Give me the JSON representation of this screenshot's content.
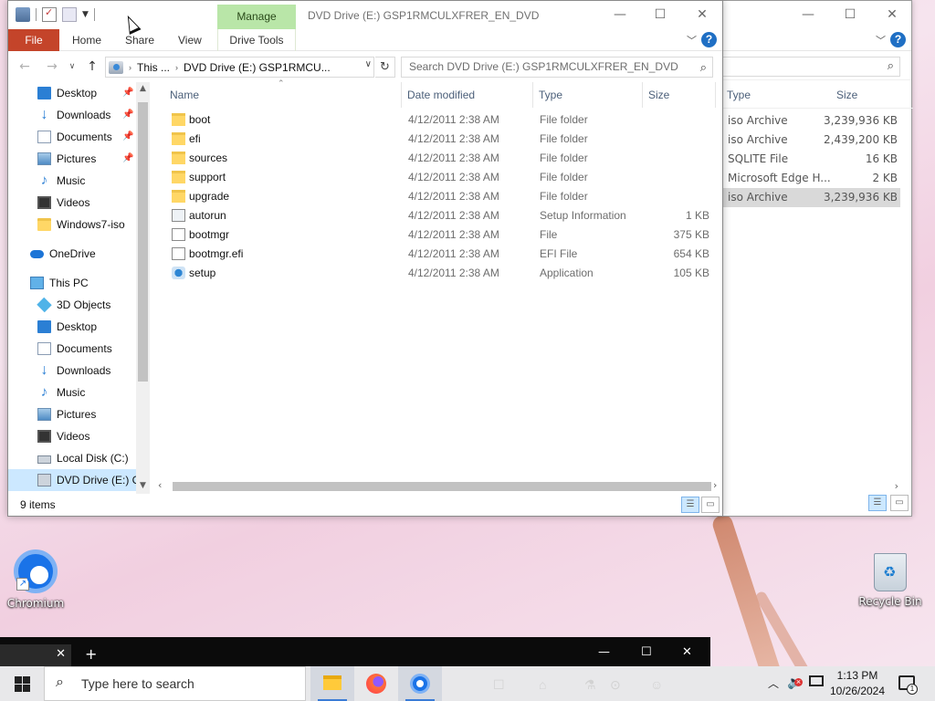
{
  "desktop": {
    "icons": [
      {
        "label": "Chromium"
      },
      {
        "label": "Recycle Bin"
      }
    ]
  },
  "background_window": {
    "columns": [
      "Type",
      "Size"
    ],
    "rows": [
      {
        "type": "iso Archive",
        "size": "3,239,936 KB",
        "selected": false
      },
      {
        "type": "iso Archive",
        "size": "2,439,200 KB",
        "selected": false
      },
      {
        "type": "SQLITE File",
        "size": "16 KB",
        "selected": false
      },
      {
        "type": "Microsoft Edge H...",
        "size": "2 KB",
        "selected": false
      },
      {
        "type": "iso Archive",
        "size": "3,239,936 KB",
        "selected": true
      }
    ]
  },
  "explorer": {
    "title": "DVD Drive (E:) GSP1RMCULXFRER_EN_DVD",
    "context_tab": "Manage",
    "ribbon_tabs": {
      "file": "File",
      "home": "Home",
      "share": "Share",
      "view": "View",
      "drive_tools": "Drive Tools"
    },
    "caption_buttons": {
      "minimize": "—",
      "maximize": "☐",
      "close": "✕"
    },
    "address": {
      "segments": [
        "This ...",
        "DVD Drive (E:) GSP1RMCU..."
      ]
    },
    "search": {
      "placeholder": "Search DVD Drive (E:) GSP1RMCULXFRER_EN_DVD"
    },
    "nav": [
      {
        "label": "Desktop",
        "icon": "desktop-icon",
        "pinned": true,
        "level": 1,
        "selected": false
      },
      {
        "label": "Downloads",
        "icon": "download-icon",
        "pinned": true,
        "level": 1,
        "selected": false
      },
      {
        "label": "Documents",
        "icon": "document-icon",
        "pinned": true,
        "level": 1,
        "selected": false
      },
      {
        "label": "Pictures",
        "icon": "pictures-icon",
        "pinned": true,
        "level": 1,
        "selected": false
      },
      {
        "label": "Music",
        "icon": "music-icon",
        "pinned": false,
        "level": 1,
        "selected": false
      },
      {
        "label": "Videos",
        "icon": "video-icon",
        "pinned": false,
        "level": 1,
        "selected": false
      },
      {
        "label": "Windows7-iso",
        "icon": "folder-icon",
        "pinned": false,
        "level": 1,
        "selected": false
      },
      {
        "label": "OneDrive",
        "icon": "cloud-icon",
        "pinned": false,
        "level": 0,
        "selected": false
      },
      {
        "label": "This PC",
        "icon": "pc-icon",
        "pinned": false,
        "level": 0,
        "selected": false
      },
      {
        "label": "3D Objects",
        "icon": "3d-objects-icon",
        "pinned": false,
        "level": 1,
        "selected": false
      },
      {
        "label": "Desktop",
        "icon": "desktop-icon",
        "pinned": false,
        "level": 1,
        "selected": false
      },
      {
        "label": "Documents",
        "icon": "document-icon",
        "pinned": false,
        "level": 1,
        "selected": false
      },
      {
        "label": "Downloads",
        "icon": "download-icon",
        "pinned": false,
        "level": 1,
        "selected": false
      },
      {
        "label": "Music",
        "icon": "music-icon",
        "pinned": false,
        "level": 1,
        "selected": false
      },
      {
        "label": "Pictures",
        "icon": "pictures-icon",
        "pinned": false,
        "level": 1,
        "selected": false
      },
      {
        "label": "Videos",
        "icon": "video-icon",
        "pinned": false,
        "level": 1,
        "selected": false
      },
      {
        "label": "Local Disk (C:)",
        "icon": "disk-icon",
        "pinned": false,
        "level": 1,
        "selected": false
      },
      {
        "label": "DVD Drive (E:) GS",
        "icon": "dvd-icon",
        "pinned": false,
        "level": 1,
        "selected": true
      }
    ],
    "columns": {
      "name": "Name",
      "date": "Date modified",
      "type": "Type",
      "size": "Size"
    },
    "files": [
      {
        "name": "boot",
        "date": "4/12/2011 2:38 AM",
        "type": "File folder",
        "size": "",
        "icon": "folder-icon"
      },
      {
        "name": "efi",
        "date": "4/12/2011 2:38 AM",
        "type": "File folder",
        "size": "",
        "icon": "folder-icon"
      },
      {
        "name": "sources",
        "date": "4/12/2011 2:38 AM",
        "type": "File folder",
        "size": "",
        "icon": "folder-icon"
      },
      {
        "name": "support",
        "date": "4/12/2011 2:38 AM",
        "type": "File folder",
        "size": "",
        "icon": "folder-icon"
      },
      {
        "name": "upgrade",
        "date": "4/12/2011 2:38 AM",
        "type": "File folder",
        "size": "",
        "icon": "folder-icon"
      },
      {
        "name": "autorun",
        "date": "4/12/2011 2:38 AM",
        "type": "Setup Information",
        "size": "1 KB",
        "icon": "setup-info-icon"
      },
      {
        "name": "bootmgr",
        "date": "4/12/2011 2:38 AM",
        "type": "File",
        "size": "375 KB",
        "icon": "file-icon"
      },
      {
        "name": "bootmgr.efi",
        "date": "4/12/2011 2:38 AM",
        "type": "EFI File",
        "size": "654 KB",
        "icon": "file-icon"
      },
      {
        "name": "setup",
        "date": "4/12/2011 2:38 AM",
        "type": "Application",
        "size": "105 KB",
        "icon": "application-icon"
      }
    ],
    "status": "9 items"
  },
  "taskbar": {
    "search_placeholder": "Type here to search",
    "time": "1:13 PM",
    "date": "10/26/2024",
    "notification_count": "1"
  },
  "colors": {
    "file_tab": "#c4442a",
    "manage_tab": "#b9e6a8",
    "selection": "#cce8ff",
    "help": "#1f6fc4"
  }
}
